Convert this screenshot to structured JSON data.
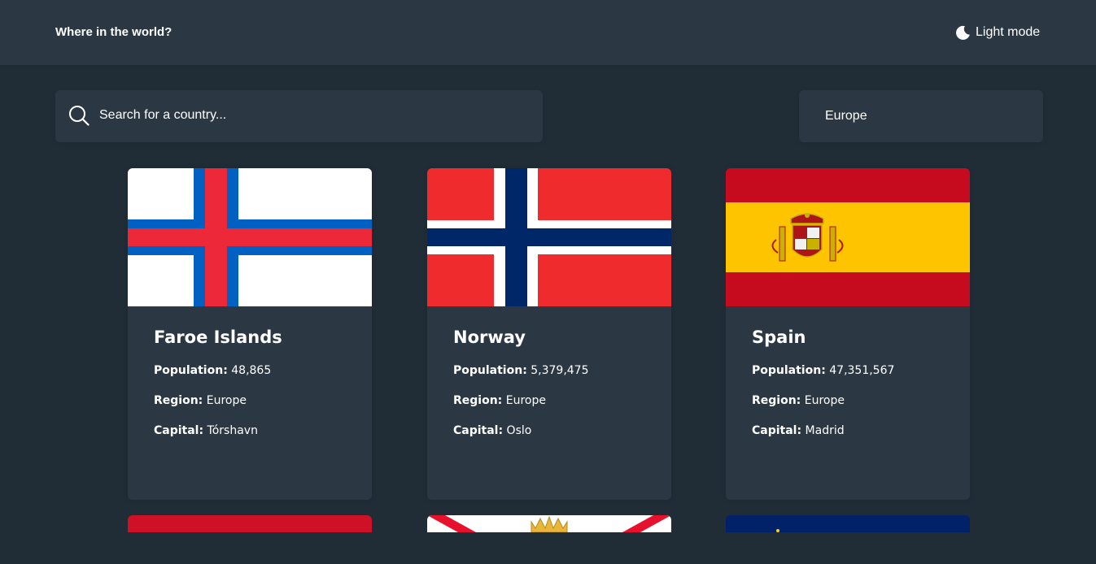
{
  "header": {
    "title": "Where in the world?",
    "theme_toggle_label": "Light mode",
    "theme_icon": "moon-icon"
  },
  "search": {
    "placeholder": "Search for a country...",
    "value": "",
    "icon": "search-icon"
  },
  "filter": {
    "selected": "Europe"
  },
  "labels": {
    "population": "Population:",
    "region": "Region:",
    "capital": "Capital:"
  },
  "countries": [
    {
      "name": "Faroe Islands",
      "population": "48,865",
      "region": "Europe",
      "capital": "Tórshavn",
      "flag": "faroe-islands-flag"
    },
    {
      "name": "Norway",
      "population": "5,379,475",
      "region": "Europe",
      "capital": "Oslo",
      "flag": "norway-flag"
    },
    {
      "name": "Spain",
      "population": "47,351,567",
      "region": "Europe",
      "capital": "Madrid",
      "flag": "spain-flag"
    }
  ],
  "partial_flags": [
    "red-flag",
    "jersey-flag",
    "blue-flag"
  ],
  "colors": {
    "background": "#202c36",
    "surface": "#2b3844",
    "text": "#ffffff"
  }
}
